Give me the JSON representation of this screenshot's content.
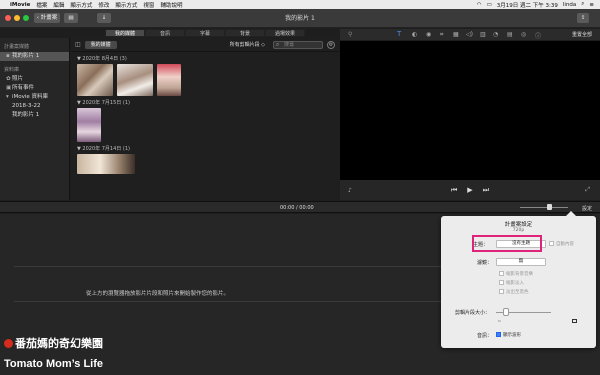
{
  "menubar": {
    "app": "iMovie",
    "items": [
      "檔案",
      "編輯",
      "顯示方式",
      "修改",
      "顯示方式",
      "視窗",
      "輔助說明"
    ],
    "clock": "3月19日 週二 下午 3:39",
    "user": "linda"
  },
  "toolbar": {
    "back_label": "‹ 計畫案",
    "title": "我的影片 1",
    "reset_label": "重置全部"
  },
  "browser_tabs": [
    "我的媒體",
    "音訊",
    "字幕",
    "背景",
    "過場效果"
  ],
  "sidebar": {
    "section1": "計畫案媒體",
    "project": "我的影片 1",
    "section2": "資料庫",
    "items": [
      "照片",
      "所有事件",
      "iMovie 資料庫",
      "2018-3-22",
      "我的影片 1"
    ]
  },
  "browser": {
    "media_label": "我的媒體",
    "filter_label": "所有剪輯片段 ◇",
    "search_placeholder": "搜尋",
    "groups": [
      {
        "date": "▼ 2020年 8月4日  (3)"
      },
      {
        "date": "▼ 2020年 7月15日  (1)"
      },
      {
        "date": "▼ 2020年 7月14日  (1)"
      }
    ]
  },
  "timeline": {
    "timecode": "00:00 / 00:00",
    "settings_label": "設定",
    "message": "從上方的瀏覽器拖放影片片段和照片來開始製作您的影片。"
  },
  "panel": {
    "title": "計畫案設定",
    "resolution": "720p",
    "theme_label": "主題：",
    "theme_value": "沒有主題",
    "auto_content": "自動內容",
    "filter_label": "濾鏡：",
    "filter_value": "無",
    "check1": "縮影背景音樂",
    "check2": "縮影淡入",
    "check3": "淡出至黑色",
    "size_label": "剪輯片段大小：",
    "audio_label": "音訊：",
    "audio_check": "顯示波形"
  },
  "watermark": {
    "line1": "番茄媽的奇幻樂園",
    "line2": "Tomato Mom’s Life"
  },
  "colors": {
    "accent_highlight": "#e0237a",
    "watermark_dot": "#d62b1e"
  }
}
